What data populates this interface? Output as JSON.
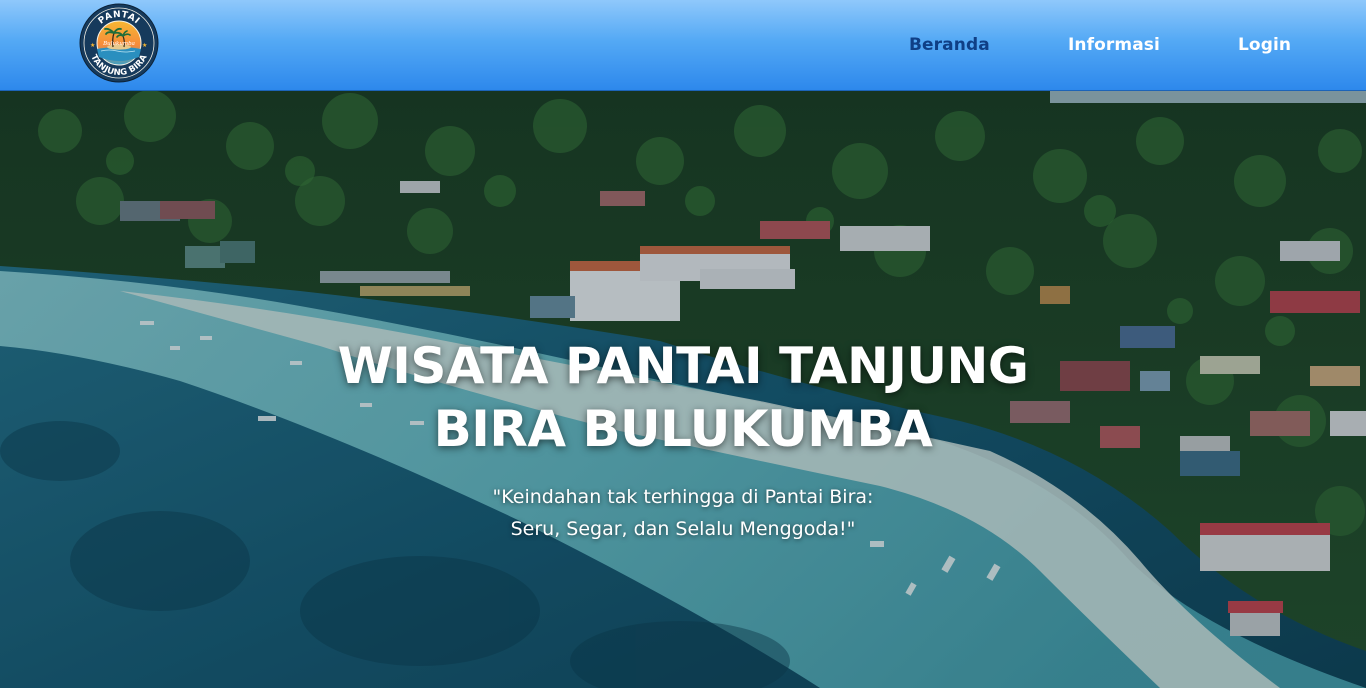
{
  "header": {
    "logo": {
      "top_text": "PANTAI",
      "script_text": "Bulukumba",
      "bottom_text": "TANJUNG BIRA"
    },
    "nav": [
      {
        "label": "Beranda",
        "active": true
      },
      {
        "label": "Informasi",
        "active": false
      },
      {
        "label": "Login",
        "active": false
      }
    ]
  },
  "hero": {
    "title_line1": "WISATA PANTAI TANJUNG",
    "title_line2": "BIRA BULUKUMBA",
    "tagline_line1": "\"Keindahan tak terhingga di Pantai Bira:",
    "tagline_line2": "Seru, Segar, dan Selalu Menggoda!\""
  },
  "colors": {
    "header_top": "#8fc8fb",
    "header_bottom": "#2d88ec",
    "nav_active": "#0f3f86",
    "nav_text": "#ffffff"
  }
}
